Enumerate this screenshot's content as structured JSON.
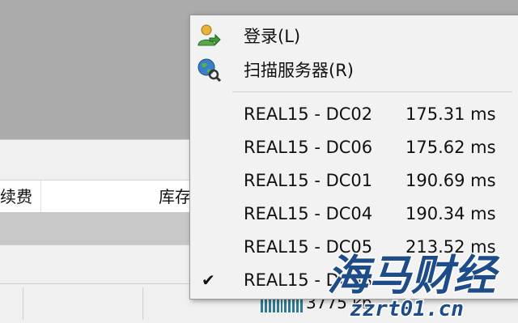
{
  "table": {
    "columns": [
      "续费",
      "库存"
    ]
  },
  "status": {
    "size_text": "3775 kb"
  },
  "menu": {
    "login_label": "登录(L)",
    "scan_label": "扫描服务器(R)",
    "servers": [
      {
        "name": "REAL15 - DC02",
        "ping": "175.31 ms",
        "checked": false
      },
      {
        "name": "REAL15 - DC06",
        "ping": "175.62 ms",
        "checked": false
      },
      {
        "name": "REAL15 - DC01",
        "ping": "190.69 ms",
        "checked": false
      },
      {
        "name": "REAL15 - DC04",
        "ping": "190.34 ms",
        "checked": false
      },
      {
        "name": "REAL15 - DC05",
        "ping": "213.52 ms",
        "checked": false
      },
      {
        "name": "REAL15 - DC03",
        "ping": "",
        "checked": true
      }
    ]
  },
  "watermark": {
    "title": "海马财经",
    "url": "zzrt01.cn"
  },
  "icons": {
    "login": "user-login-icon",
    "scan": "globe-search-icon",
    "check": "checkmark-icon"
  },
  "colors": {
    "menu_bg": "#f2f2f2",
    "watermark_fill": "#1e4c88",
    "signal": "#2f7a8f"
  }
}
